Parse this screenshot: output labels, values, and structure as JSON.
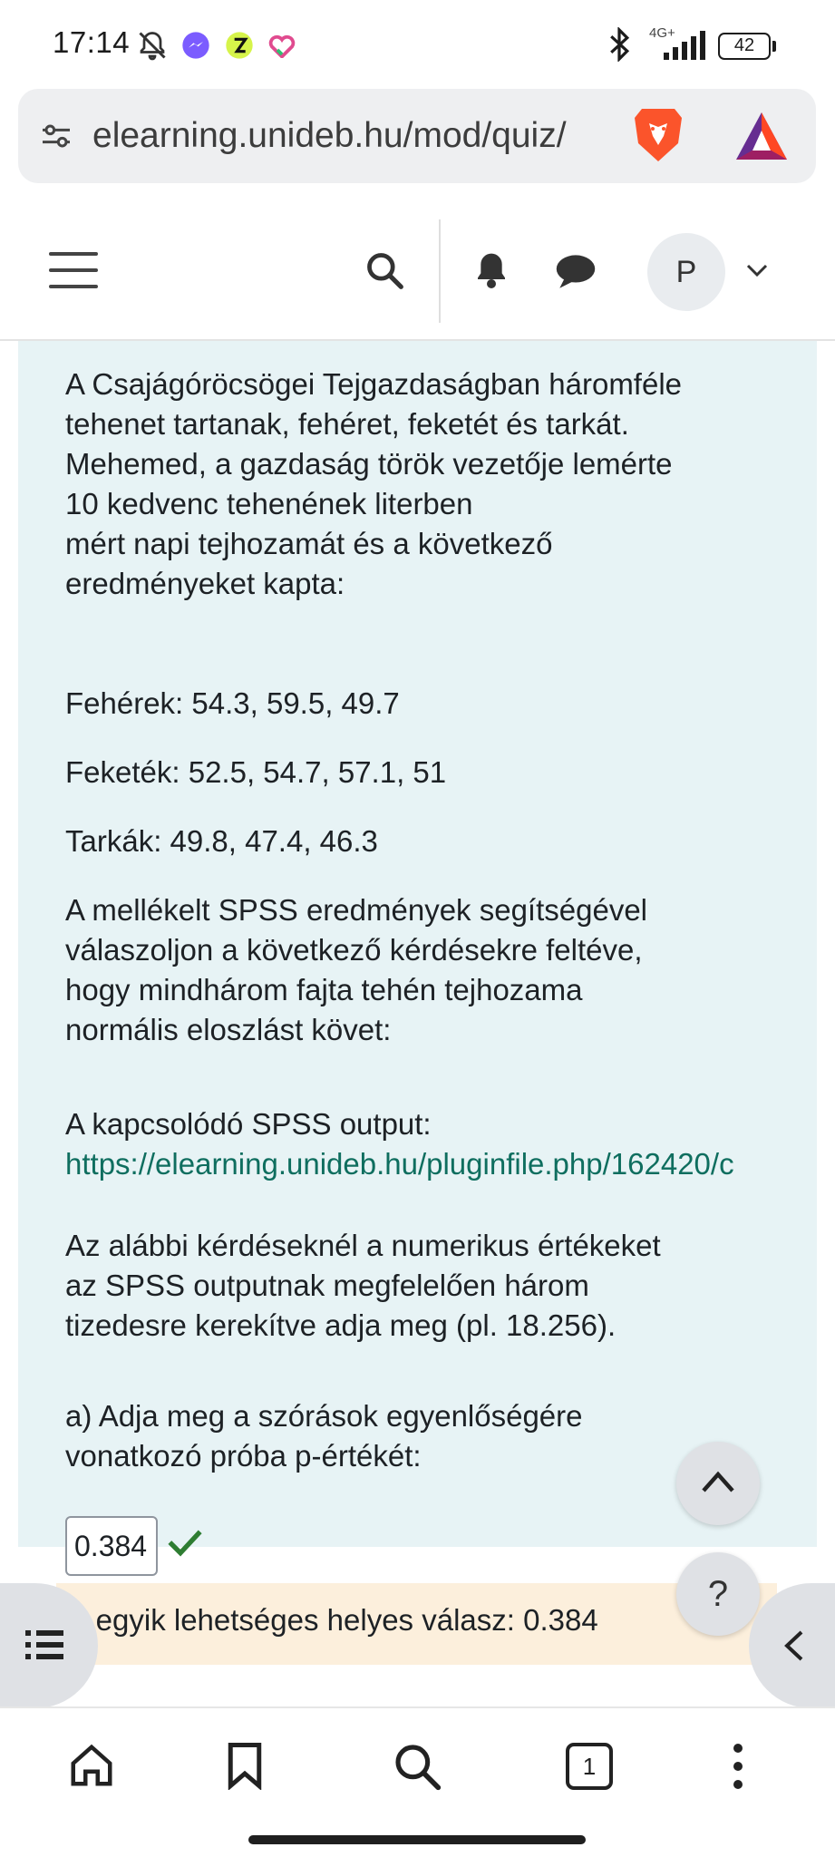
{
  "status_bar": {
    "time": "17:14",
    "network": "4G+",
    "battery": "42",
    "icons": [
      "mute-icon",
      "messenger-icon",
      "app-icon",
      "heart-icon",
      "bluetooth-icon",
      "signal-icon",
      "battery-icon"
    ]
  },
  "browser": {
    "url": "elearning.unideb.hu/mod/quiz/",
    "tab_count": "1",
    "toolbar_icons": [
      "home-icon",
      "bookmark-icon",
      "search-icon",
      "tabs-icon",
      "more-menu-icon"
    ]
  },
  "site_nav": {
    "avatar_initial": "P",
    "icons": [
      "hamburger-menu-icon",
      "search-icon",
      "notifications-bell-icon",
      "messages-icon",
      "chevron-down-icon"
    ]
  },
  "question": {
    "intro_lines": [
      "A Csajágóröcsögei Tejgazdaságban háromféle",
      "tehenet tartanak, fehéret, feketét és tarkát.",
      "Mehemed, a gazdaság török vezetője lemérte",
      "10 kedvenc tehenének literben",
      "mért napi tejhozamát és a következő",
      "eredményeket kapta:"
    ],
    "group_white": "Fehérek: 54.3, 59.5, 49.7",
    "group_black": "Feketék: 52.5, 54.7, 57.1, 51",
    "group_spotted": "Tarkák: 49.8, 47.4, 46.3",
    "instruction_lines": [
      "A mellékelt SPSS eredmények segítségével",
      "válaszoljon a következő kérdésekre feltéve,",
      "hogy mindhárom fajta tehén tejhozama",
      "normális eloszlást követ:"
    ],
    "spss_label": "A kapcsolódó SPSS output:",
    "spss_link": "https://elearning.unideb.hu/pluginfile.php/162420/c",
    "rounding_lines": [
      "Az alábbi kérdéseknél a numerikus értékeket",
      "az SPSS outputnak megfelelően három",
      "tizedesre kerekítve adja meg (pl. 18.256)."
    ],
    "part_a_lines": [
      "a) Adja meg a szórások egyenlőségére",
      "vonatkozó próba p-értékét:"
    ],
    "answer_value": "0.384",
    "feedback": "z egyik lehetséges helyes válasz: 0.384"
  },
  "floating_buttons": {
    "help_label": "?",
    "icons": [
      "scroll-up-icon",
      "help-icon",
      "drawer-index-icon",
      "drawer-collapse-icon"
    ]
  },
  "colors": {
    "content_bg": "#e7f3f5",
    "link": "#0f6e5f",
    "correct_check": "#2e7d32",
    "feedback_bg": "#fcefdc",
    "brave_orange": "#fb542b"
  }
}
